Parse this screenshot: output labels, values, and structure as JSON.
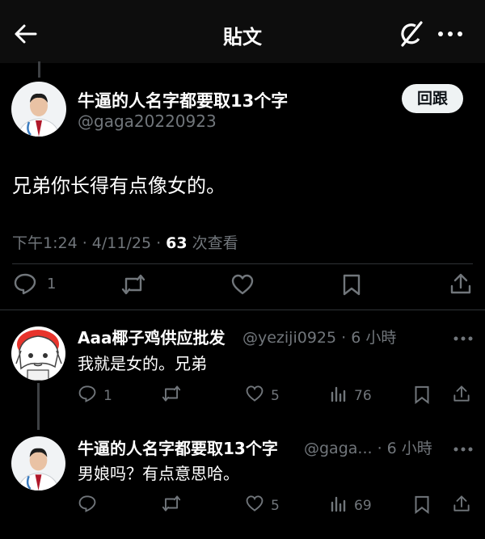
{
  "header": {
    "title": "貼文"
  },
  "post": {
    "display_name": "牛逼的人名字都要取13个字",
    "handle": "@gaga20220923",
    "follow_label": "回跟",
    "text": "兄弟你长得有点像女的。",
    "timestamp": "下午1:24 · 4/11/25 · ",
    "views_count": "63",
    "views_label": " 次查看",
    "reply_count": "1"
  },
  "replies": [
    {
      "display_name": "Aaa椰子鸡供应批发",
      "handle_time": "@yeziji0925 · 6 小時",
      "text": "我就是女的。兄弟",
      "reply_count": "1",
      "like_count": "5",
      "view_count": "76"
    },
    {
      "display_name": "牛逼的人名字都要取13个字",
      "handle_time": "@gaga... · 6 小時",
      "text": "男娘吗？有点意思哈。",
      "reply_count": "",
      "like_count": "5",
      "view_count": "69"
    }
  ],
  "icons": {
    "back": "arrow-left-icon",
    "grok": "grok-icon",
    "more": "more-horizontal-icon",
    "reply": "reply-icon",
    "retweet": "retweet-icon",
    "like": "heart-icon",
    "bookmark": "bookmark-icon",
    "share": "share-icon",
    "views": "views-chart-icon"
  },
  "colors": {
    "background": "#000000",
    "muted": "#71767b",
    "divider": "#2f3336",
    "button_bg": "#eff3f4"
  }
}
